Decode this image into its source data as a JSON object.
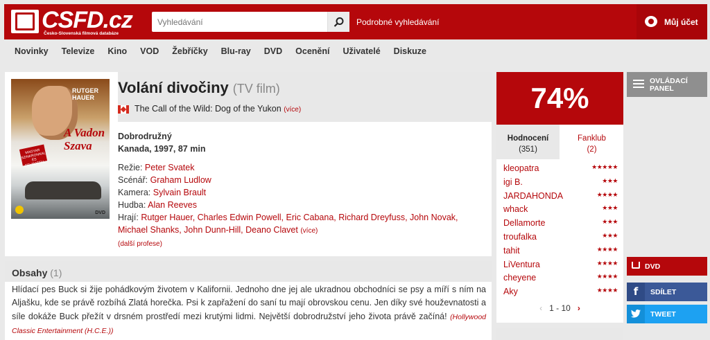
{
  "header": {
    "logo_text": "CSFD.cz",
    "logo_sub": "Česko-Slovenská filmová databáze",
    "search_placeholder": "Vyhledávání",
    "advanced_search": "Podrobné vyhledávání",
    "account": "Můj účet"
  },
  "nav": [
    "Novinky",
    "Televize",
    "Kino",
    "VOD",
    "Žebříčky",
    "Blu-ray",
    "DVD",
    "Ocenění",
    "Uživatelé",
    "Diskuze"
  ],
  "film": {
    "title": "Volání divočiny",
    "type": "(TV film)",
    "original_title": "The Call of the Wild: Dog of the Yukon",
    "more": "(více)",
    "genre": "Dobrodružný",
    "meta": "Kanada, 1997, 87 min",
    "directing_label": "Režie:",
    "director": "Peter Svatek",
    "screenplay_label": "Scénář:",
    "screenplay": "Graham Ludlow",
    "camera_label": "Kamera:",
    "camera": "Sylvain Brault",
    "music_label": "Hudba:",
    "music": "Alan Reeves",
    "cast_label": "Hrají:",
    "cast": "Rutger Hauer, Charles Edwin Powell, Eric Cabana, Richard Dreyfuss, John Novak, Michael Shanks, John Dunn-Hill, Deano Clavet",
    "cast_more": "(více)",
    "other_professions": "(další profese)",
    "poster": {
      "actor": "RUTGER HAUER",
      "title": "A Vadon Szava",
      "badge": "MAGYAR SZINKRONNAL ÉS FELIRATTAL",
      "dvd": "DVD"
    }
  },
  "plot": {
    "heading": "Obsahy",
    "count": "(1)",
    "text": "Hlídací pes Buck si žije pohádkovým životem v Kalifornii. Jednoho dne jej ale ukradnou obchodníci se psy a míří s ním na Aljašku, kde se právě rozbíhá Zlatá horečka. Psi k zapřažení do saní tu mají obrovskou cenu. Jen díky své houževnatosti a síle dokáže Buck přežít v drsném prostředí mezi krutými lidmi. Největší dobrodružství jeho života právě začíná!",
    "source": "(Hollywood Classic Entertainment (H.C.E.))"
  },
  "rating": {
    "percent": "74%",
    "tab_ratings": "Hodnocení",
    "tab_ratings_count": "(351)",
    "tab_fanclub": "Fanklub",
    "tab_fanclub_count": "(2)",
    "users": [
      {
        "name": "kleopatra",
        "stars": "★★★★★"
      },
      {
        "name": "igi B.",
        "stars": "★★★"
      },
      {
        "name": "JARDAHONDA",
        "stars": "★★★★"
      },
      {
        "name": "whack",
        "stars": "★★★"
      },
      {
        "name": "Dellamorte",
        "stars": "★★★"
      },
      {
        "name": "troufalka",
        "stars": "★★★"
      },
      {
        "name": "tahit",
        "stars": "★★★★"
      },
      {
        "name": "LiVentura",
        "stars": "★★★★"
      },
      {
        "name": "cheyene",
        "stars": "★★★★"
      },
      {
        "name": "Aky",
        "stars": "★★★★"
      }
    ],
    "pager": "1 - 10",
    "pager_prev": "‹",
    "pager_next": "›"
  },
  "side": {
    "panel_line1": "OVLÁDACÍ",
    "panel_line2": "PANEL",
    "dvd": "DVD",
    "share": "SDÍLET",
    "tweet": "TWEET",
    "fb_letter": "f",
    "tw_glyph": "🐦"
  },
  "colors": {
    "brand": "#b5070b",
    "facebook": "#3b5998",
    "twitter": "#1da1f2"
  }
}
